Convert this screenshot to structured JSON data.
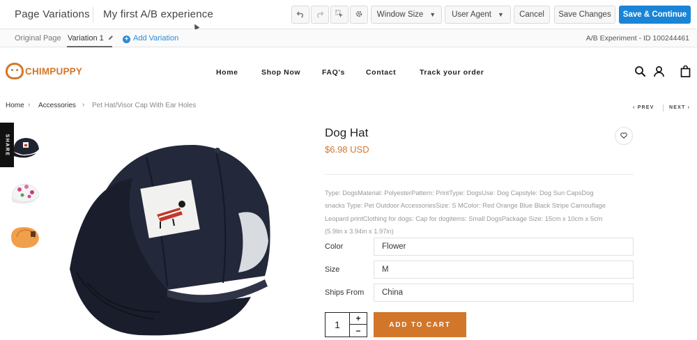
{
  "editor": {
    "section_title": "Page Variations",
    "experience_name": "My first A/B experience",
    "buttons": {
      "undo_icon": "undo-icon",
      "redo_icon": "redo-icon",
      "select_icon": "element-select-icon",
      "settings_icon": "gear-icon",
      "window_size": "Window Size",
      "user_agent": "User Agent",
      "cancel": "Cancel",
      "save": "Save Changes",
      "save_continue": "Save & Continue"
    },
    "tabs": {
      "original": "Original Page",
      "variation": "Variation 1",
      "add": "Add Variation"
    },
    "experiment_id": "A/B Experiment - ID 100244461",
    "accent_color": "#1a84d6"
  },
  "store": {
    "brand": "CHIMPUPPY",
    "brand_color": "#d2762a",
    "nav": [
      "Home",
      "Shop Now",
      "FAQ's",
      "Contact",
      "Track your order"
    ],
    "header_icons": [
      "search-icon",
      "user-icon",
      "bag-icon"
    ]
  },
  "breadcrumb": [
    "Home",
    "Accessories",
    "Pet Hat/Visor Cap With Ear Holes"
  ],
  "pager": {
    "prev": "PREV",
    "next": "NEXT"
  },
  "share_label": "SHARE",
  "product": {
    "title": "Dog Hat",
    "price": "$6.98 USD",
    "description": [
      "Type: DogsMaterial: PolyesterPattern: PrintType: DogsUse: Dog Capstyle: Dog Sun CapsDog",
      "snacks Type: Pet Outdoor AccessoriesSize: S MColor: Red Orange Blue Black Stripe Camouflage",
      "Leopard printClothing for dogs: Cap for dogitems: Small DogsPackage Size: 15cm x 10cm x 5cm",
      "(5.9lin x 3.94in x 1.97in)"
    ],
    "options": [
      {
        "label": "Color",
        "value": "Flower"
      },
      {
        "label": "Size",
        "value": "M"
      },
      {
        "label": "Ships From",
        "value": "China"
      }
    ],
    "quantity": "1",
    "qty_plus": "+",
    "qty_minus": "−",
    "add_to_cart": "ADD TO CART"
  }
}
